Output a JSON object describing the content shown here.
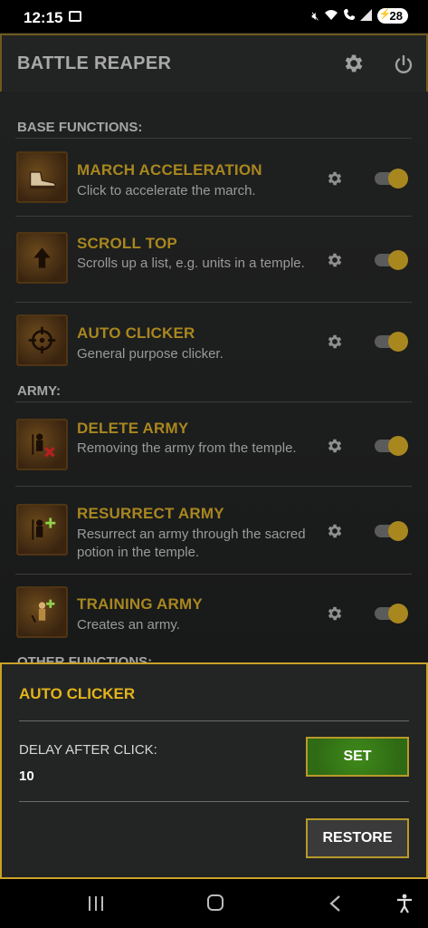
{
  "status": {
    "time": "12:15",
    "battery": "28"
  },
  "appbar": {
    "title": "BATTLE REAPER"
  },
  "sections": {
    "base": "BASE FUNCTIONS:",
    "army": "ARMY:",
    "other": "OTHER FUNCTIONS:"
  },
  "items": [
    {
      "name": "MARCH ACCELERATION",
      "desc": "Click to accelerate the march.",
      "icon": "boot-icon",
      "enabled": true
    },
    {
      "name": "SCROLL TOP",
      "desc": "Scrolls up a list, e.g. units in a temple.",
      "icon": "arrow-up-icon",
      "enabled": true
    },
    {
      "name": "AUTO CLICKER",
      "desc": "General purpose clicker.",
      "icon": "crosshair-icon",
      "enabled": true
    },
    {
      "name": "DELETE ARMY",
      "desc": "Removing the army from the temple.",
      "icon": "delete-army-icon",
      "enabled": true
    },
    {
      "name": "RESURRECT ARMY",
      "desc": "Resurrect an army through the sacred potion in the temple.",
      "icon": "resurrect-army-icon",
      "enabled": true
    },
    {
      "name": "TRAINING ARMY",
      "desc": "Creates an army.",
      "icon": "training-army-icon",
      "enabled": true
    }
  ],
  "sheet": {
    "title": "AUTO CLICKER",
    "delay_label": "DELAY AFTER CLICK:",
    "delay_value": "10",
    "set_label": "SET",
    "restore_label": "RESTORE"
  },
  "colors": {
    "accent": "#a8871f",
    "sheet_title": "#e3b41a",
    "set_button": "#2f6a14"
  }
}
